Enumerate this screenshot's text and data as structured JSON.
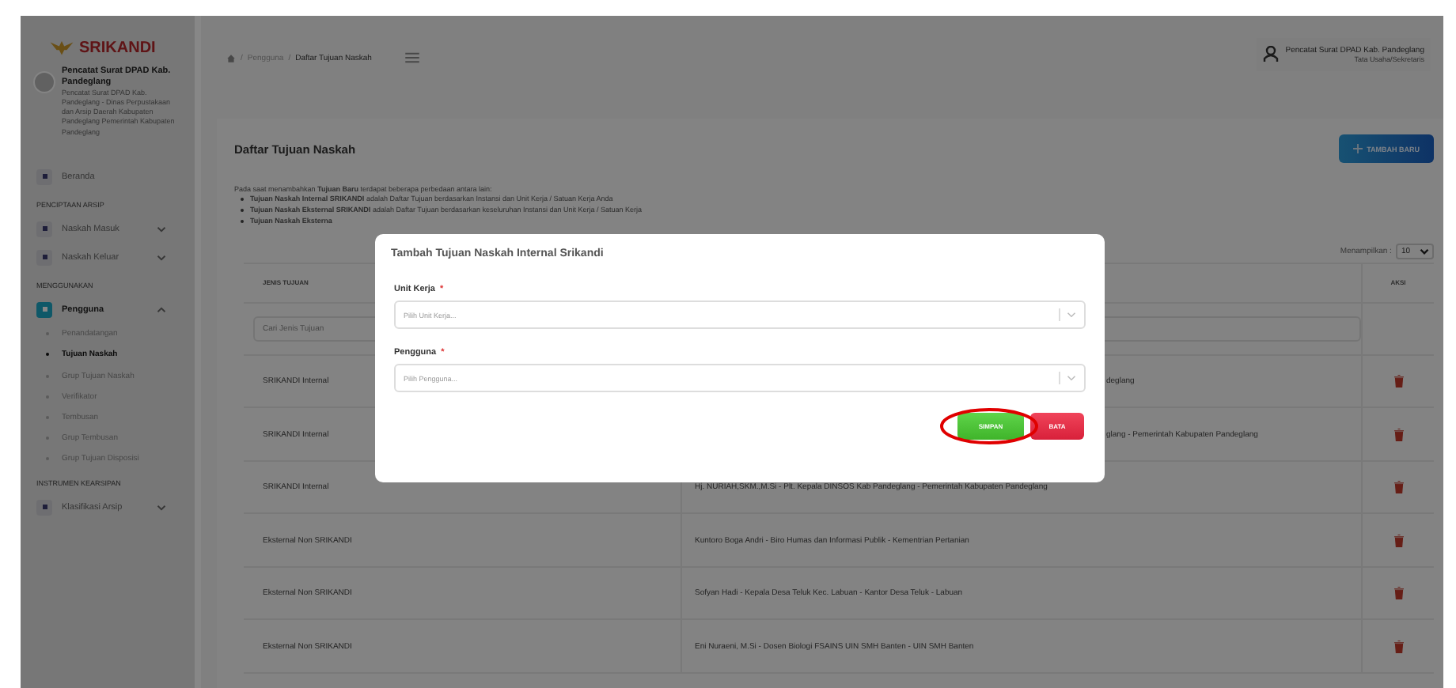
{
  "sidebar": {
    "logo": "SRIKANDI",
    "user_name": "Pencatat Surat DPAD Kab. Pandeglang",
    "user_desc": "Pencatat Surat DPAD Kab. Pandeglang - Dinas Perpustakaan dan Arsip Daerah Kabupaten Pandeglang Pemerintah Kabupaten Pandeglang",
    "menu": [
      {
        "kind": "item",
        "label": "Beranda",
        "selected": false
      },
      {
        "kind": "section",
        "label": "PENCIPTAAN ARSIP"
      },
      {
        "kind": "item",
        "label": "Naskah Masuk",
        "selected": false,
        "expanded": false
      },
      {
        "kind": "item",
        "label": "Naskah Keluar",
        "selected": false,
        "expanded": false
      },
      {
        "kind": "section",
        "label": "MENGGUNAKAN"
      },
      {
        "kind": "item",
        "label": "Pengguna",
        "selected": true,
        "expanded": true,
        "children": [
          {
            "label": "Penandatangan",
            "selected": false
          },
          {
            "label": "Tujuan Naskah",
            "selected": true
          },
          {
            "label": "Grup Tujuan Naskah",
            "selected": false
          },
          {
            "label": "Verifikator",
            "selected": false
          },
          {
            "label": "Tembusan",
            "selected": false
          },
          {
            "label": "Grup Tembusan",
            "selected": false
          },
          {
            "label": "Grup Tujuan Disposisi",
            "selected": false
          }
        ]
      },
      {
        "kind": "section",
        "label": "INSTRUMEN KEARSIPAN"
      },
      {
        "kind": "item",
        "label": "Klasifikasi Arsip",
        "selected": false,
        "expanded": false
      }
    ]
  },
  "header": {
    "breadcrumb": [
      "Pengguna",
      "Daftar Tujuan Naskah"
    ],
    "separator": "/",
    "user_name": "Pencatat Surat DPAD Kab. Pandeglang",
    "user_role": "Tata Usaha/Sekretaris"
  },
  "card": {
    "title": "Daftar Tujuan Naskah",
    "add_button": "TAMBAH BARU",
    "intro": "Pada saat menambahkan **Tujuan Baru** terdapat beberapa perbedaan antara lain:",
    "bullets": [
      "**Tujuan Naskah Internal SRIKANDI** adalah Daftar Tujuan berdasarkan Instansi dan Unit Kerja / Satuan Kerja Anda",
      "**Tujuan Naskah Eksternal SRIKANDI** adalah Daftar Tujuan berdasarkan keseluruhan Instansi dan Unit Kerja / Satuan Kerja",
      "**Tujuan Naskah Eksterna**"
    ],
    "page_size_label": "Menampilkan :",
    "page_size": "10"
  },
  "table": {
    "columns": [
      "JENIS TUJUAN",
      "AKSI"
    ],
    "search_placeholder": "Cari Jenis Tujuan",
    "rows": [
      {
        "jenis": "SRIKANDI Internal",
        "tujuan": "deglang"
      },
      {
        "jenis": "SRIKANDI Internal",
        "tujuan": "glang - Pemerintah Kabupaten Pandeglang"
      },
      {
        "jenis": "SRIKANDI Internal",
        "tujuan": "Hj. NURIAH,SKM.,M.Si - Plt. Kepala DINSOS Kab Pandeglang - Pemerintah Kabupaten Pandeglang"
      },
      {
        "jenis": "Eksternal Non SRIKANDI",
        "tujuan": "Kuntoro Boga Andri - Biro Humas dan Informasi Publik - Kementrian Pertanian"
      },
      {
        "jenis": "Eksternal Non SRIKANDI",
        "tujuan": "Sofyan Hadi - Kepala Desa Teluk Kec. Labuan - Kantor Desa Teluk - Labuan"
      },
      {
        "jenis": "Eksternal Non SRIKANDI",
        "tujuan": "Eni Nuraeni, M.Si - Dosen Biologi FSAINS UIN SMH Banten - UIN SMH Banten"
      }
    ]
  },
  "modal": {
    "title": "Tambah Tujuan Naskah Internal Srikandi",
    "fields": [
      {
        "label": "Unit Kerja",
        "required_mark": "*",
        "placeholder": "Pilih Unit Kerja..."
      },
      {
        "label": "Pengguna",
        "required_mark": "*",
        "placeholder": "Pilih Pengguna..."
      }
    ],
    "save_button": "SIMPAN",
    "cancel_button": "BATA",
    "save_highlighted": true
  }
}
